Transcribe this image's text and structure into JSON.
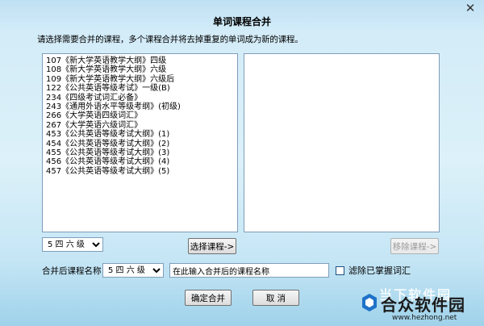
{
  "window": {
    "title": "单词课程合并",
    "close_glyph": "✕"
  },
  "instruction": "请选择需要合并的课程，多个课程合并将去掉重复的单词成为新的课程。",
  "left_list": {
    "items": [
      "107《新大学英语教学大纲》四级",
      "108《新大学英语教学大纲》六级",
      "109《新大学英语教学大纲》六级后",
      "122《公共英语等级考试》一级(B)",
      "234《四级考试词汇必备》",
      "243《通用外语水平等级考纲》(初级)",
      "266《大学英语四级词汇》",
      "267《大学英语六级词汇》",
      "453《公共英语等级考试大纲》(1)",
      "454《公共英语等级考试大纲》(2)",
      "455《公共英语等级考试大纲》(3)",
      "456《公共英语等级考试大纲》(4)",
      "457《公共英语等级考试大纲》(5)"
    ]
  },
  "level_select": {
    "value": "5 四 六 级"
  },
  "buttons": {
    "select_course": "选择课程->",
    "remove_course": "移除课程->",
    "confirm": "确定合并",
    "cancel": "取 消"
  },
  "merged": {
    "label": "合并后课程名称",
    "level_value": "5 四 六 级",
    "name_value": "在此输入合并后的课程名称",
    "filter_label": "滤除已掌握词汇"
  },
  "watermark": {
    "top": "当下软件园",
    "main": "合众软件园",
    "url": "www.hezhong.net"
  },
  "colors": {
    "list_border": "#7f9db9",
    "logo": "#1e72c8"
  }
}
